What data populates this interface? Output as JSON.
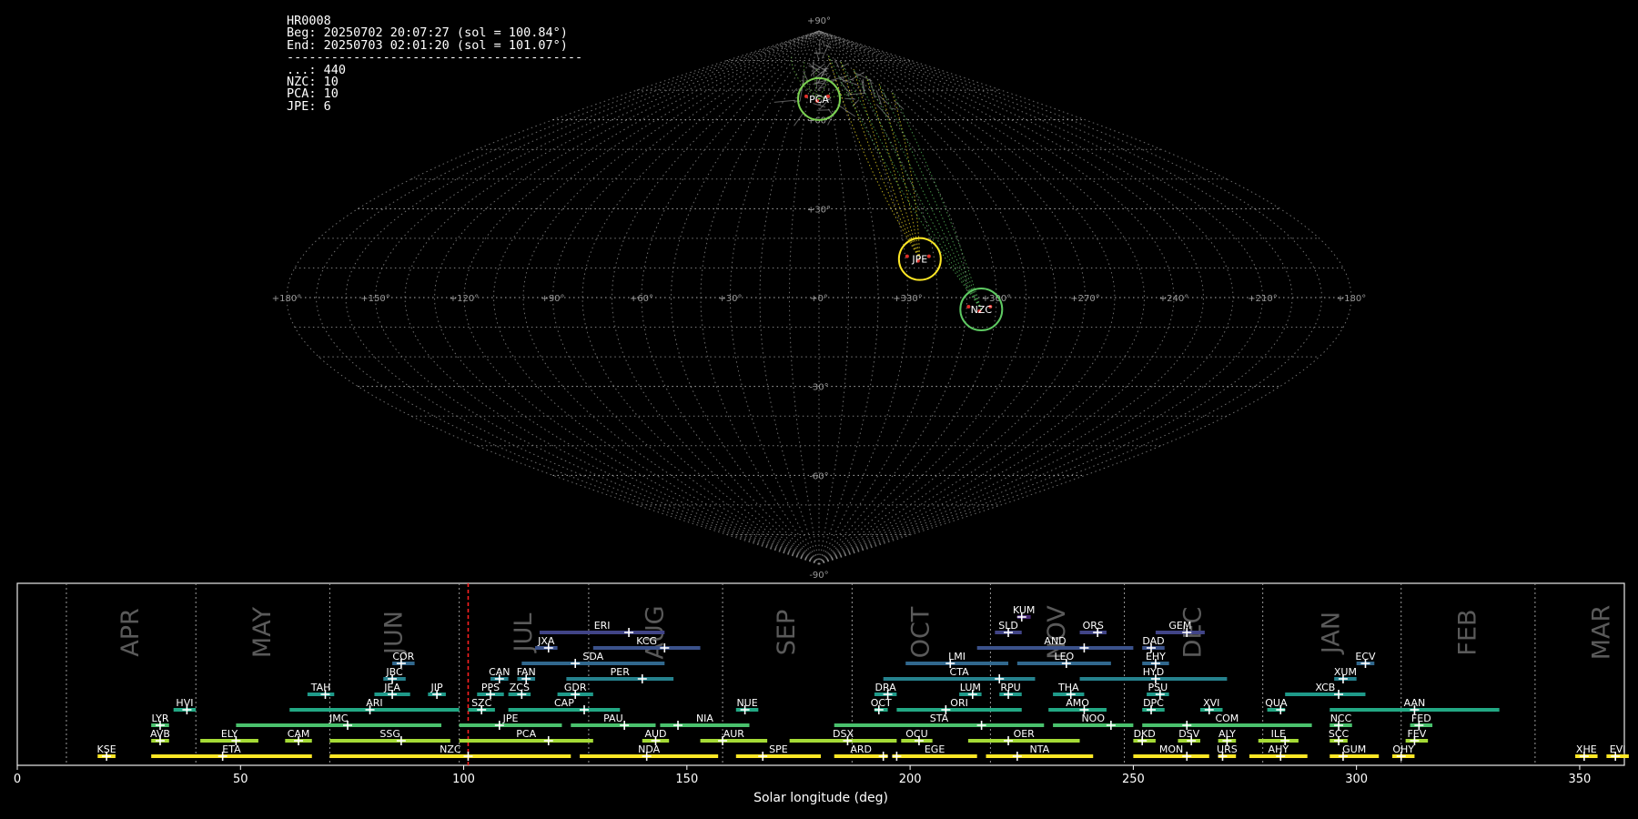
{
  "header": {
    "station": "HR0008",
    "begin": "Beg: 20250702 20:07:27 (sol = 100.84°)",
    "end": "End: 20250703 02:01:20 (sol = 101.07°)",
    "separator": "----------------------------------------",
    "counts": [
      {
        "label": "...: 440"
      },
      {
        "label": "NZC: 10"
      },
      {
        "label": "PCA: 10"
      },
      {
        "label": "JPE: 6"
      }
    ]
  },
  "chart_data": [
    {
      "type": "scatter",
      "projection": "sinusoidal all-sky map",
      "lon_ticks": [
        "+180°",
        "+150°",
        "+120°",
        "+90°",
        "+60°",
        "+30°",
        "+0°",
        "+330°",
        "+300°",
        "+270°",
        "+240°",
        "+210°",
        "+180°"
      ],
      "lat_ticks": [
        "+90°",
        "+60°",
        "+30°",
        "-30°",
        "-60°",
        "-90°"
      ],
      "radiants": [
        {
          "name": "PCA",
          "lon": 0,
          "lat": 67,
          "color": "#7ad151"
        },
        {
          "name": "JPE",
          "lon": 325,
          "lat": 13,
          "color": "#fde725"
        },
        {
          "name": "NZC",
          "lon": 305,
          "lat": -4,
          "color": "#5ec962"
        }
      ],
      "background_label": "...",
      "grid": true
    },
    {
      "type": "timeline",
      "xlabel": "Solar longitude (deg)",
      "xlim": [
        0,
        360
      ],
      "xticks": [
        0,
        50,
        100,
        150,
        200,
        250,
        300,
        350
      ],
      "current_sol": 101,
      "months": [
        {
          "label": "APR",
          "start": 11,
          "end": 40
        },
        {
          "label": "MAY",
          "start": 40,
          "end": 70
        },
        {
          "label": "JUN",
          "start": 70,
          "end": 99
        },
        {
          "label": "JUL",
          "start": 99,
          "end": 128
        },
        {
          "label": "AUG",
          "start": 128,
          "end": 158
        },
        {
          "label": "SEP",
          "start": 158,
          "end": 187
        },
        {
          "label": "OCT",
          "start": 187,
          "end": 218
        },
        {
          "label": "NOV",
          "start": 218,
          "end": 248
        },
        {
          "label": "DEC",
          "start": 248,
          "end": 279
        },
        {
          "label": "JAN",
          "start": 279,
          "end": 310
        },
        {
          "label": "FEB",
          "start": 310,
          "end": 340
        },
        {
          "label": "MAR",
          "start": 340,
          "end": 371
        }
      ],
      "showers": [
        {
          "name": "KUM",
          "row": 9,
          "start": 224,
          "end": 227,
          "peak": 225
        },
        {
          "name": "ERI",
          "row": 8,
          "start": 117,
          "end": 145,
          "peak": 137
        },
        {
          "name": "SLD",
          "row": 8,
          "start": 219,
          "end": 225,
          "peak": 222
        },
        {
          "name": "ORS",
          "row": 8,
          "start": 238,
          "end": 244,
          "peak": 242
        },
        {
          "name": "GEM",
          "row": 8,
          "start": 255,
          "end": 266,
          "peak": 262
        },
        {
          "name": "JXA",
          "row": 7,
          "start": 116,
          "end": 121,
          "peak": 119
        },
        {
          "name": "KCG",
          "row": 7,
          "start": 129,
          "end": 153,
          "peak": 145
        },
        {
          "name": "AND",
          "row": 7,
          "start": 215,
          "end": 250,
          "peak": 239
        },
        {
          "name": "DAD",
          "row": 7,
          "start": 252,
          "end": 257,
          "peak": 254
        },
        {
          "name": "COR",
          "row": 6,
          "start": 84,
          "end": 89,
          "peak": 86
        },
        {
          "name": "SDA",
          "row": 6,
          "start": 113,
          "end": 145,
          "peak": 125
        },
        {
          "name": "LMI",
          "row": 6,
          "start": 199,
          "end": 222,
          "peak": 209
        },
        {
          "name": "LEO",
          "row": 6,
          "start": 224,
          "end": 245,
          "peak": 235
        },
        {
          "name": "EHY",
          "row": 6,
          "start": 252,
          "end": 258,
          "peak": 255
        },
        {
          "name": "ECV",
          "row": 6,
          "start": 300,
          "end": 304,
          "peak": 302
        },
        {
          "name": "JBC",
          "row": 5,
          "start": 82,
          "end": 87,
          "peak": 84
        },
        {
          "name": "CAN",
          "row": 5,
          "start": 106,
          "end": 110,
          "peak": 108
        },
        {
          "name": "FAN",
          "row": 5,
          "start": 112,
          "end": 116,
          "peak": 114
        },
        {
          "name": "PER",
          "row": 5,
          "start": 123,
          "end": 147,
          "peak": 140
        },
        {
          "name": "CTA",
          "row": 5,
          "start": 194,
          "end": 228,
          "peak": 220
        },
        {
          "name": "HYD",
          "row": 5,
          "start": 238,
          "end": 271,
          "peak": 255
        },
        {
          "name": "XUM",
          "row": 5,
          "start": 295,
          "end": 300,
          "peak": 297
        },
        {
          "name": "TAH",
          "row": 4,
          "start": 65,
          "end": 71,
          "peak": 69
        },
        {
          "name": "JEA",
          "row": 4,
          "start": 80,
          "end": 88,
          "peak": 84
        },
        {
          "name": "JIP",
          "row": 4,
          "start": 92,
          "end": 96,
          "peak": 94
        },
        {
          "name": "PPS",
          "row": 4,
          "start": 103,
          "end": 109,
          "peak": 106
        },
        {
          "name": "ZCS",
          "row": 4,
          "start": 110,
          "end": 115,
          "peak": 113
        },
        {
          "name": "GDR",
          "row": 4,
          "start": 121,
          "end": 129,
          "peak": 125
        },
        {
          "name": "DRA",
          "row": 4,
          "start": 192,
          "end": 197,
          "peak": 195
        },
        {
          "name": "LUM",
          "row": 4,
          "start": 211,
          "end": 216,
          "peak": 214
        },
        {
          "name": "RPU",
          "row": 4,
          "start": 220,
          "end": 225,
          "peak": 222
        },
        {
          "name": "THA",
          "row": 4,
          "start": 232,
          "end": 239,
          "peak": 236
        },
        {
          "name": "PSU",
          "row": 4,
          "start": 253,
          "end": 258,
          "peak": 256
        },
        {
          "name": "XCB",
          "row": 4,
          "start": 284,
          "end": 302,
          "peak": 296
        },
        {
          "name": "HVI",
          "row": 3,
          "start": 35,
          "end": 40,
          "peak": 38
        },
        {
          "name": "ARI",
          "row": 3,
          "start": 61,
          "end": 99,
          "peak": 79
        },
        {
          "name": "SZC",
          "row": 3,
          "start": 101,
          "end": 107,
          "peak": 104
        },
        {
          "name": "CAP",
          "row": 3,
          "start": 110,
          "end": 135,
          "peak": 127
        },
        {
          "name": "NUE",
          "row": 3,
          "start": 161,
          "end": 166,
          "peak": 163
        },
        {
          "name": "OCT",
          "row": 3,
          "start": 192,
          "end": 195,
          "peak": 193
        },
        {
          "name": "ORI",
          "row": 3,
          "start": 197,
          "end": 225,
          "peak": 208
        },
        {
          "name": "AMO",
          "row": 3,
          "start": 231,
          "end": 244,
          "peak": 239
        },
        {
          "name": "DPC",
          "row": 3,
          "start": 252,
          "end": 257,
          "peak": 254
        },
        {
          "name": "XVI",
          "row": 3,
          "start": 265,
          "end": 270,
          "peak": 267
        },
        {
          "name": "QUA",
          "row": 3,
          "start": 280,
          "end": 284,
          "peak": 283
        },
        {
          "name": "AAN",
          "row": 3,
          "start": 294,
          "end": 332,
          "peak": 313
        },
        {
          "name": "LYR",
          "row": 2,
          "start": 30,
          "end": 34,
          "peak": 32
        },
        {
          "name": "JMC",
          "row": 2,
          "start": 49,
          "end": 95,
          "peak": 74
        },
        {
          "name": "JPE",
          "row": 2,
          "start": 99,
          "end": 122,
          "peak": 108
        },
        {
          "name": "PAU",
          "row": 2,
          "start": 124,
          "end": 143,
          "peak": 136
        },
        {
          "name": "NIA",
          "row": 2,
          "start": 144,
          "end": 164,
          "peak": 148
        },
        {
          "name": "STA",
          "row": 2,
          "start": 183,
          "end": 230,
          "peak": 216
        },
        {
          "name": "NOO",
          "row": 2,
          "start": 232,
          "end": 250,
          "peak": 245
        },
        {
          "name": "COM",
          "row": 2,
          "start": 252,
          "end": 290,
          "peak": 262
        },
        {
          "name": "NCC",
          "row": 2,
          "start": 294,
          "end": 299,
          "peak": 296
        },
        {
          "name": "FED",
          "row": 2,
          "start": 312,
          "end": 317,
          "peak": 314
        },
        {
          "name": "AVB",
          "row": 1,
          "start": 30,
          "end": 34,
          "peak": 32
        },
        {
          "name": "ELY",
          "row": 1,
          "start": 41,
          "end": 54,
          "peak": 49
        },
        {
          "name": "CAM",
          "row": 1,
          "start": 60,
          "end": 66,
          "peak": 63
        },
        {
          "name": "SSG",
          "row": 1,
          "start": 70,
          "end": 97,
          "peak": 86
        },
        {
          "name": "PCA",
          "row": 1,
          "start": 99,
          "end": 129,
          "peak": 119
        },
        {
          "name": "AUD",
          "row": 1,
          "start": 140,
          "end": 146,
          "peak": 143
        },
        {
          "name": "AUR",
          "row": 1,
          "start": 153,
          "end": 168,
          "peak": 158
        },
        {
          "name": "DSX",
          "row": 1,
          "start": 173,
          "end": 197,
          "peak": 186
        },
        {
          "name": "OCU",
          "row": 1,
          "start": 198,
          "end": 205,
          "peak": 202
        },
        {
          "name": "OER",
          "row": 1,
          "start": 213,
          "end": 238,
          "peak": 222
        },
        {
          "name": "DKD",
          "row": 1,
          "start": 250,
          "end": 255,
          "peak": 252
        },
        {
          "name": "DSV",
          "row": 1,
          "start": 260,
          "end": 265,
          "peak": 263
        },
        {
          "name": "ALY",
          "row": 1,
          "start": 269,
          "end": 273,
          "peak": 271
        },
        {
          "name": "ILE",
          "row": 1,
          "start": 278,
          "end": 287,
          "peak": 284
        },
        {
          "name": "SCC",
          "row": 1,
          "start": 294,
          "end": 298,
          "peak": 296
        },
        {
          "name": "FEV",
          "row": 1,
          "start": 311,
          "end": 316,
          "peak": 313
        },
        {
          "name": "KSE",
          "row": 0,
          "start": 18,
          "end": 22,
          "peak": 20
        },
        {
          "name": "ETA",
          "row": 0,
          "start": 30,
          "end": 66,
          "peak": 46
        },
        {
          "name": "NZC",
          "row": 0,
          "start": 70,
          "end": 124,
          "peak": 101
        },
        {
          "name": "NDA",
          "row": 0,
          "start": 126,
          "end": 157,
          "peak": 141
        },
        {
          "name": "SPE",
          "row": 0,
          "start": 161,
          "end": 180,
          "peak": 167
        },
        {
          "name": "ARD",
          "row": 0,
          "start": 183,
          "end": 195,
          "peak": 194
        },
        {
          "name": "EGE",
          "row": 0,
          "start": 196,
          "end": 215,
          "peak": 197
        },
        {
          "name": "NTA",
          "row": 0,
          "start": 217,
          "end": 241,
          "peak": 224
        },
        {
          "name": "MON",
          "row": 0,
          "start": 250,
          "end": 267,
          "peak": 262
        },
        {
          "name": "URS",
          "row": 0,
          "start": 269,
          "end": 273,
          "peak": 270
        },
        {
          "name": "AHY",
          "row": 0,
          "start": 276,
          "end": 289,
          "peak": 283
        },
        {
          "name": "GUM",
          "row": 0,
          "start": 294,
          "end": 305,
          "peak": 297
        },
        {
          "name": "OHY",
          "row": 0,
          "start": 308,
          "end": 313,
          "peak": 310
        },
        {
          "name": "XHE",
          "row": 0,
          "start": 349,
          "end": 354,
          "peak": 351
        },
        {
          "name": "EVI",
          "row": 0,
          "start": 356,
          "end": 361,
          "peak": 358
        }
      ]
    }
  ]
}
